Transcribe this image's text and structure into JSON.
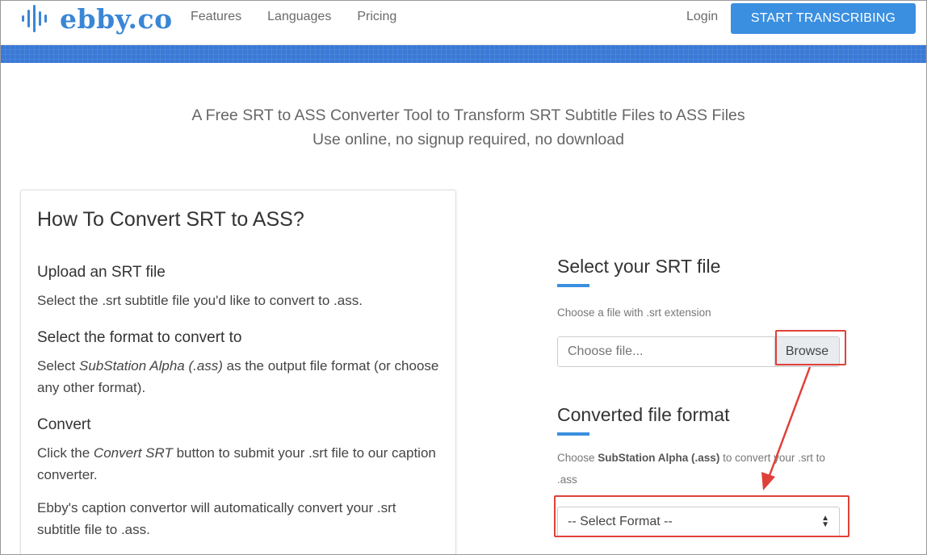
{
  "brand": {
    "name": "ebby.co",
    "color": "#3a86d6"
  },
  "nav": {
    "links": [
      "Features",
      "Languages",
      "Pricing"
    ],
    "login": "Login",
    "cta": "START TRANSCRIBING"
  },
  "hero": {
    "line1": "A Free SRT to ASS Converter Tool to Transform SRT Subtitle Files to ASS Files",
    "line2": "Use online, no signup required, no download"
  },
  "howto": {
    "title": "How To Convert SRT to ASS?",
    "steps": [
      {
        "heading": "Upload an SRT file",
        "text": "Select the .srt subtitle file you'd like to convert to .ass."
      },
      {
        "heading": "Select the format to convert to",
        "text_pre": "Select ",
        "text_em": "SubStation Alpha (.ass)",
        "text_post": " as the output file format (or choose any other format)."
      },
      {
        "heading": "Convert",
        "text_pre": "Click the ",
        "text_em": "Convert SRT",
        "text_post": " button to submit your .srt file to our caption converter."
      }
    ],
    "footer_text": "Ebby's caption convertor will automatically convert your .srt subtitle file to .ass."
  },
  "form": {
    "select_title": "Select your SRT file",
    "select_help": "Choose a file with .srt extension",
    "file_placeholder": "Choose file...",
    "browse": "Browse",
    "format_title": "Converted file format",
    "format_help_pre": "Choose ",
    "format_help_bold": "SubStation Alpha (.ass)",
    "format_help_post": " to convert your .srt to .ass",
    "select_value": "-- Select Format --"
  },
  "colors": {
    "accent": "#3a8fe0",
    "annotation": "#e0403a",
    "stripe": "#3a79d6"
  }
}
